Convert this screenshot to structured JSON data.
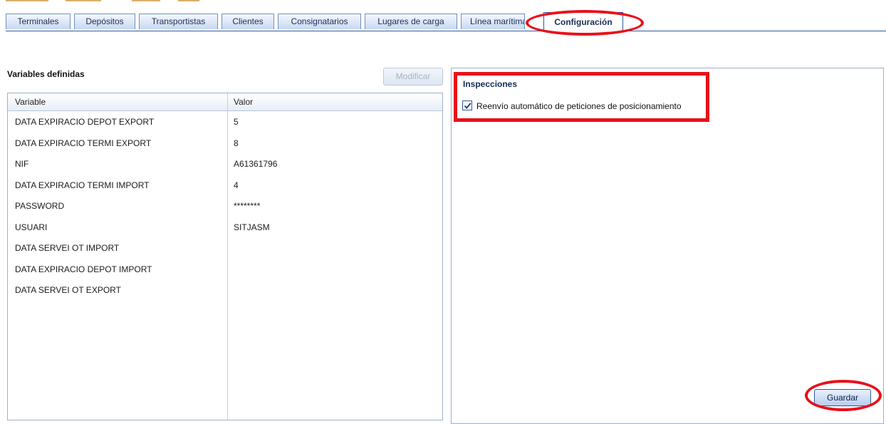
{
  "tabs": [
    {
      "label": "Terminales"
    },
    {
      "label": "Depósitos"
    },
    {
      "label": "Transportistas"
    },
    {
      "label": "Clientes"
    },
    {
      "label": "Consignatarios"
    },
    {
      "label": "Lugares de carga"
    },
    {
      "label": "Línea marítima"
    },
    {
      "label": "Configuración",
      "active": true
    }
  ],
  "left": {
    "title": "Variables definidas",
    "modify_button": "Modificar",
    "columns": {
      "variable": "Variable",
      "value": "Valor"
    },
    "rows": [
      {
        "variable": "DATA EXPIRACIO DEPOT EXPORT",
        "value": "5"
      },
      {
        "variable": "DATA EXPIRACIO TERMI EXPORT",
        "value": "8"
      },
      {
        "variable": "NIF",
        "value": "A61361796"
      },
      {
        "variable": "DATA EXPIRACIO TERMI IMPORT",
        "value": "4"
      },
      {
        "variable": "PASSWORD",
        "value": "********"
      },
      {
        "variable": "USUARI",
        "value": "SITJASM"
      },
      {
        "variable": "DATA SERVEI OT IMPORT",
        "value": ""
      },
      {
        "variable": "DATA EXPIRACIO DEPOT IMPORT",
        "value": ""
      },
      {
        "variable": "DATA SERVEI OT EXPORT",
        "value": ""
      }
    ]
  },
  "right": {
    "section_title": "Inspecciones",
    "checkbox_label": "Reenvío automático de peticiones de posicionamiento",
    "checkbox_checked": true,
    "save_button": "Guardar"
  },
  "colors": {
    "highlight": "#e8101a",
    "tab_border": "#2f5a9e"
  }
}
